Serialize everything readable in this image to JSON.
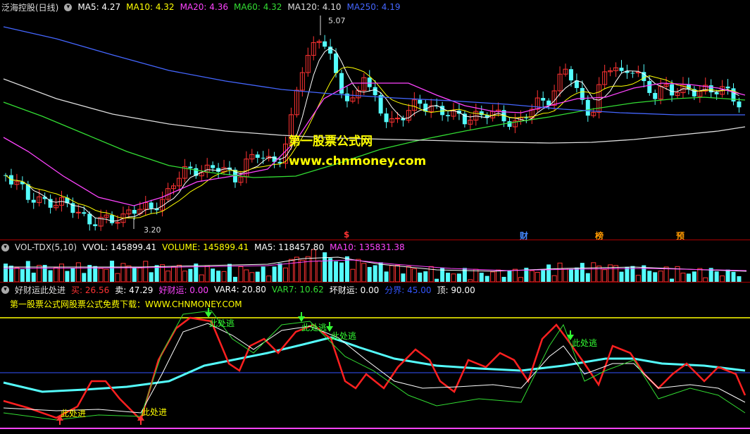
{
  "main": {
    "title": "泛海控股(日线)",
    "ma": [
      {
        "label": "MA5: 4.27",
        "color": "#ffffff"
      },
      {
        "label": "MA10: 4.32",
        "color": "#ffff00"
      },
      {
        "label": "MA20: 4.36",
        "color": "#ff44ff"
      },
      {
        "label": "MA60: 4.32",
        "color": "#33dd33"
      },
      {
        "label": "MA120: 4.10",
        "color": "#dddddd"
      },
      {
        "label": "MA250: 4.19",
        "color": "#4466ff"
      }
    ],
    "high_label": "5.07",
    "low_label": "3.20",
    "events": [
      {
        "label": "$",
        "color": "#ff3333"
      },
      {
        "label": "财",
        "color": "#4488ff"
      },
      {
        "label": "榜",
        "color": "#ff9900"
      },
      {
        "label": "预",
        "color": "#ff9900"
      }
    ],
    "watermark_cn": "第一股票公式网",
    "watermark_url": "www.chnmoney.com"
  },
  "volume": {
    "title": "VOL-TDX(5,10)",
    "items": [
      {
        "label": "VVOL: 145899.41",
        "color": "#ffffff"
      },
      {
        "label": "VOLUME: 145899.41",
        "color": "#ffff00"
      },
      {
        "label": "MA5: 118457.80",
        "color": "#ffffff"
      },
      {
        "label": "MA10: 135831.38",
        "color": "#ff44ff"
      }
    ]
  },
  "indicator": {
    "title": "好财运此处进",
    "items": [
      {
        "label": "买: 26.56",
        "color": "#ff3333"
      },
      {
        "label": "卖: 47.29",
        "color": "#ffffff"
      },
      {
        "label": "好财运: 0.00",
        "color": "#ff44ff"
      },
      {
        "label": "VAR4: 20.80",
        "color": "#ffffff"
      },
      {
        "label": "VAR7: 10.62",
        "color": "#33dd33"
      },
      {
        "label": "坏财运: 0.00",
        "color": "#ffffff"
      },
      {
        "label": "分界: 45.00",
        "color": "#3355ff"
      },
      {
        "label": "顶: 90.00",
        "color": "#ffffff"
      }
    ],
    "note": "第一股票公式网股票公式免费下载：WWW.CHNMONEY.COM",
    "buy_label": "此处进",
    "sell_label": "此处逃"
  },
  "colors": {
    "up": "#ff3333",
    "down": "#54fcfc",
    "bg": "#000000"
  }
}
